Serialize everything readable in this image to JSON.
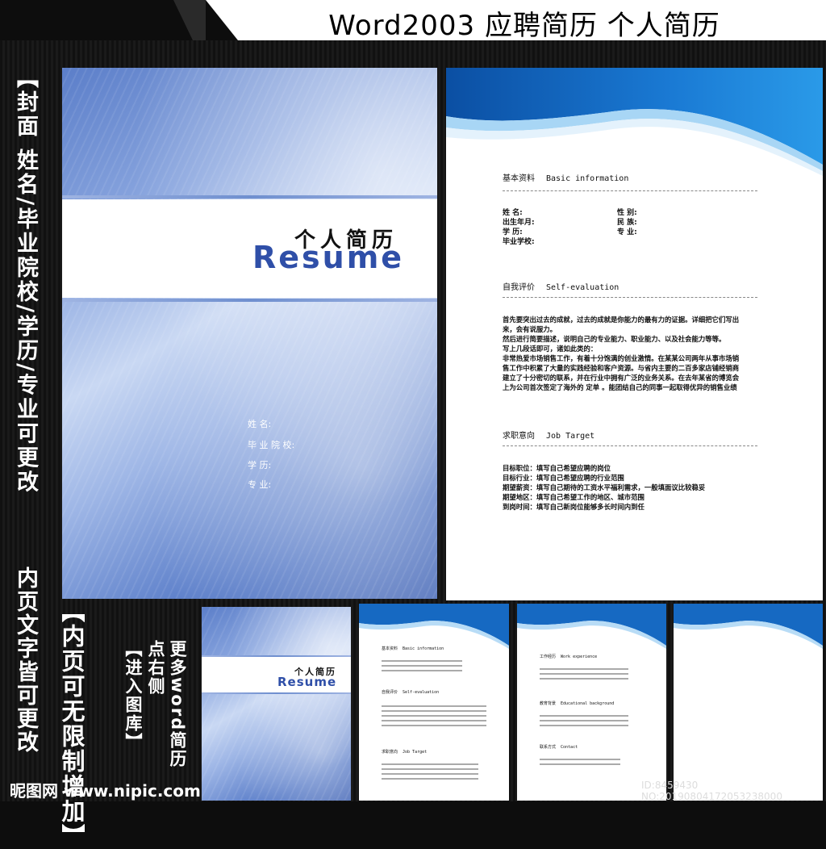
{
  "title": "Word2003  应聘简历  个人简历",
  "side_left": "【封面  姓名/毕业院校/学历/专业可更改",
  "side_left_2": "内页文字皆可更改",
  "side_mid_1": "【内页可无限制增加】",
  "side_mid_2": "【进入图库】",
  "side_mid_3": "点右侧",
  "side_mid_4": "更多word简历",
  "cover": {
    "title": "个人简历",
    "resume": "Resume",
    "fields": [
      "姓      名:",
      "毕 业 院 校:",
      "学      历:",
      "专      业:"
    ]
  },
  "page": {
    "basic_cn": "基本资料",
    "basic_en": "Basic information",
    "basic_fields_left": [
      "姓      名:",
      "出生年月:",
      "学      历:",
      "毕业学校:"
    ],
    "basic_fields_right": [
      "性      别:",
      "民      族:",
      "专      业:"
    ],
    "self_cn": "自我评价",
    "self_en": "Self-evaluation",
    "self_text": [
      "首先要突出过去的成就，过去的成就是你能力的最有力的证据。详细把它们写出",
      "来，会有说服力。",
      "然后进行简要描述，说明自己的专业能力、职业能力、以及社会能力等等。",
      "写上几段话即可，诸如此类的：",
      "非常热爱市场销售工作，有着十分饱满的创业激情。在某某公司两年从事市场销",
      "售工作中积累了大量的实践经验和客户资源。与省内主要的二百多家店铺经销商",
      "建立了十分密切的联系，并在行业中拥有广泛的业务关系。在去年某省的博览会",
      "上为公司首次签定了海外的  定单 。能团结自己的同事一起取得优异的销售业绩"
    ],
    "job_cn": "求职意向",
    "job_en": "Job Target",
    "job_text": [
      "目标职位：填写自己希望应聘的岗位",
      "目标行业：填写自己希望应聘的行业范围",
      "期望薪资：填写自己期待的工资水平福利需求，一般填面议比较稳妥",
      "期望地区：填写自己希望工作的地区、城市范围",
      "到岗时间：填写自己新岗位能够多长时间内到任"
    ]
  },
  "small_cover": {
    "title": "个人简历",
    "resume": "Resume"
  },
  "thumb2": {
    "h1": "基本资料",
    "h1_en": "Basic information",
    "h2": "自我评价",
    "h2_en": "Self-evaluation",
    "h3": "求职意向",
    "h3_en": "Job Target"
  },
  "thumb3": {
    "h1": "工作经历",
    "h1_en": "Work experience",
    "h2": "教育背景",
    "h2_en": "Educational background",
    "h3": "联系方式",
    "h3_en": "Contact"
  },
  "watermark_left": "昵图网 www.nipic.com",
  "watermark_right": "ID:8459430 NO:20190804172053238000",
  "colors": {
    "accent": "#1a6fc4",
    "cover_blue": "#4f74c4",
    "resume_blue": "#2f4fa8"
  }
}
